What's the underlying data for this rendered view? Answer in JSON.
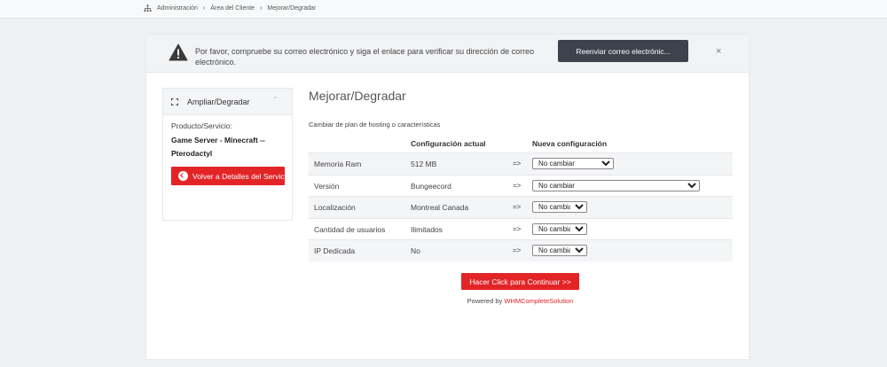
{
  "breadcrumb": {
    "items": [
      "Administración",
      "Área del Cliente",
      "Mejorar/Degradar"
    ],
    "separator": "›"
  },
  "alert": {
    "message": "Por favor, compruebe su correo electrónico y siga el enlace para verificar su dirección de correo electrónico.",
    "button_label": "Reenviar correo electrónic...",
    "close": "×"
  },
  "sidebar": {
    "title": "Ampliar/Degradar",
    "chevron": "⌃",
    "product_label": "Producto/Servicio:",
    "product_name": "Game Server - Minecraft -- Pterodactyl",
    "back_button": "Volver a Detalles del Servicio"
  },
  "main": {
    "title": "Mejorar/Degradar",
    "subtitle": "Cambiar de plan de hosting o características",
    "headers": {
      "current": "Configuración actual",
      "new": "Nueva configuración"
    },
    "arrow": "=>",
    "rows": [
      {
        "name": "Memoria Ram",
        "current": "512 MB",
        "selected": "No cambiar"
      },
      {
        "name": "Versión",
        "current": "Bungeecord",
        "selected": "No cambiar"
      },
      {
        "name": "Localización",
        "current": "Montreal Canada",
        "selected": "No cambiar"
      },
      {
        "name": "Cantidad de usuarios",
        "current": "Ilimitados",
        "selected": "No cambiar"
      },
      {
        "name": "IP Dedicada",
        "current": "No",
        "selected": "No cambiar"
      }
    ],
    "submit_button": "Hacer Click para Continuar >>",
    "powered_prefix": "Powered by ",
    "powered_link": "WHMCompleteSolution"
  },
  "colors": {
    "accent_red": "#e32427",
    "dark_button": "#3d424d"
  }
}
